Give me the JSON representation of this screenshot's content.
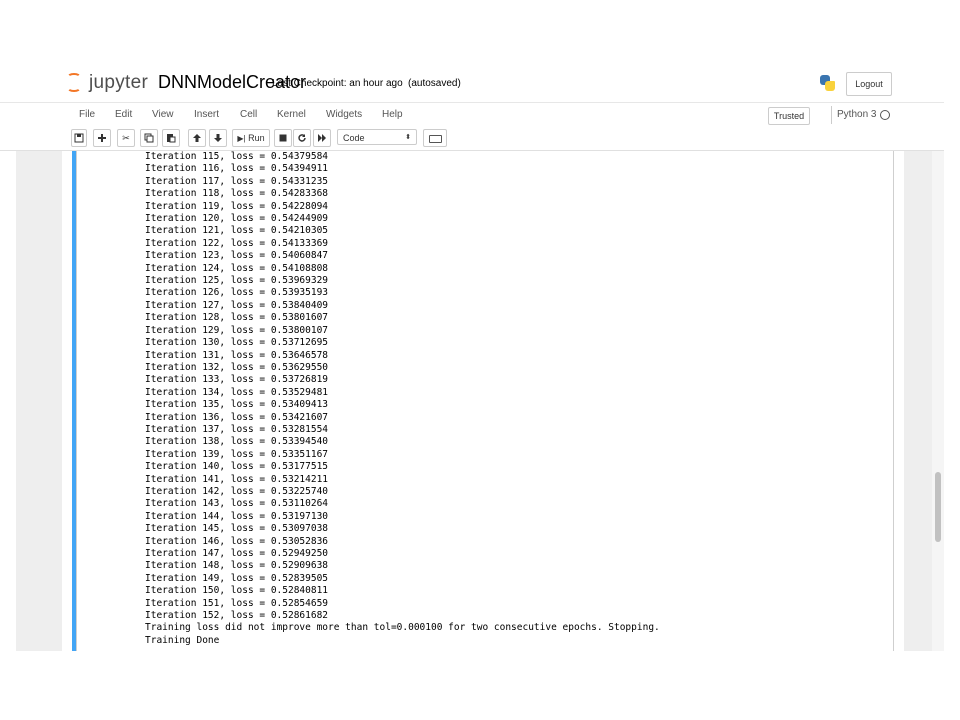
{
  "header": {
    "logo_text": "jupyter",
    "notebook_name": "DNNModelCreator",
    "checkpoint": "Last Checkpoint: an hour ago",
    "autosave_status": "(autosaved)",
    "logout_label": "Logout"
  },
  "menubar": {
    "items": [
      "File",
      "Edit",
      "View",
      "Insert",
      "Cell",
      "Kernel",
      "Widgets",
      "Help"
    ],
    "trusted_label": "Trusted",
    "kernel_name": "Python 3"
  },
  "toolbar": {
    "run_label": "Run",
    "cell_type": "Code",
    "icons": [
      "save-icon",
      "plus-icon",
      "cut-icon",
      "copy-icon",
      "paste-icon",
      "arrow-up-icon",
      "arrow-down-icon",
      "step-forward-icon",
      "stop-icon",
      "restart-icon",
      "fast-forward-icon",
      "keyboard-icon"
    ]
  },
  "output": {
    "lines": [
      "Iteration 115, loss = 0.54379584",
      "Iteration 116, loss = 0.54394911",
      "Iteration 117, loss = 0.54331235",
      "Iteration 118, loss = 0.54283368",
      "Iteration 119, loss = 0.54228094",
      "Iteration 120, loss = 0.54244909",
      "Iteration 121, loss = 0.54210305",
      "Iteration 122, loss = 0.54133369",
      "Iteration 123, loss = 0.54060847",
      "Iteration 124, loss = 0.54108808",
      "Iteration 125, loss = 0.53969329",
      "Iteration 126, loss = 0.53935193",
      "Iteration 127, loss = 0.53840409",
      "Iteration 128, loss = 0.53801607",
      "Iteration 129, loss = 0.53800107",
      "Iteration 130, loss = 0.53712695",
      "Iteration 131, loss = 0.53646578",
      "Iteration 132, loss = 0.53629550",
      "Iteration 133, loss = 0.53726819",
      "Iteration 134, loss = 0.53529481",
      "Iteration 135, loss = 0.53409413",
      "Iteration 136, loss = 0.53421607",
      "Iteration 137, loss = 0.53281554",
      "Iteration 138, loss = 0.53394540",
      "Iteration 139, loss = 0.53351167",
      "Iteration 140, loss = 0.53177515",
      "Iteration 141, loss = 0.53214211",
      "Iteration 142, loss = 0.53225740",
      "Iteration 143, loss = 0.53110264",
      "Iteration 144, loss = 0.53197130",
      "Iteration 145, loss = 0.53097038",
      "Iteration 146, loss = 0.53052836",
      "Iteration 147, loss = 0.52949250",
      "Iteration 148, loss = 0.52909638",
      "Iteration 149, loss = 0.52839505",
      "Iteration 150, loss = 0.52840811",
      "Iteration 151, loss = 0.52854659",
      "Iteration 152, loss = 0.52861682",
      "Training loss did not improve more than tol=0.000100 for two consecutive epochs. Stopping.",
      "Training Done"
    ]
  },
  "colors": {
    "accent_orange": "#f37626",
    "cell_selected_bar": "#42a5f5",
    "site_background": "#eeeeee"
  }
}
